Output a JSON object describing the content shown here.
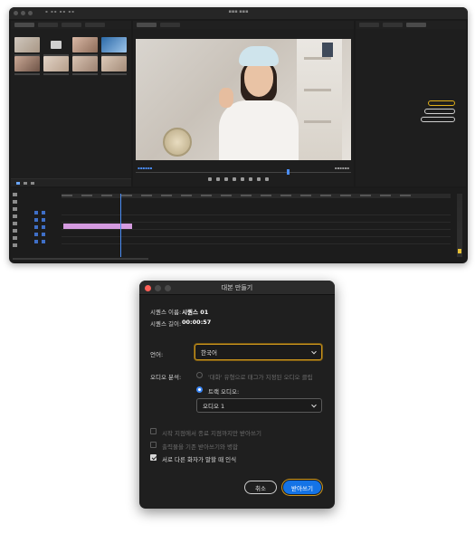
{
  "dialog": {
    "title": "대본 만들기",
    "sequence_name_label": "시퀀스 이름:",
    "sequence_name_value": "시퀀스 01",
    "sequence_length_label": "시퀀스 길이:",
    "sequence_length_value": "00:00:57",
    "language_label": "언어:",
    "language_value": "한국어",
    "audio_analysis_label": "오디오 분석:",
    "radio_dialogue_clips": "'대화' 유형으로 태그가 지정된 오디오 클립",
    "radio_track_audio": "트랙 오디오:",
    "track_select_value": "오디오 1",
    "check_in_out": "시작 지점에서 종료 지점까지만 받아쓰기",
    "check_merge": "출력물을 기존 받아쓰기와 병합",
    "check_speakers": "서로 다른 화자가 말할 때 인식",
    "cancel_label": "취소",
    "transcribe_label": "받아쓰기",
    "accent_color": "#1473e6",
    "highlight_color": "#c9941d"
  },
  "app": {
    "name": "Adobe Premiere Pro",
    "accent_color": "#4b8df5",
    "clip_color": "#d59be0"
  }
}
